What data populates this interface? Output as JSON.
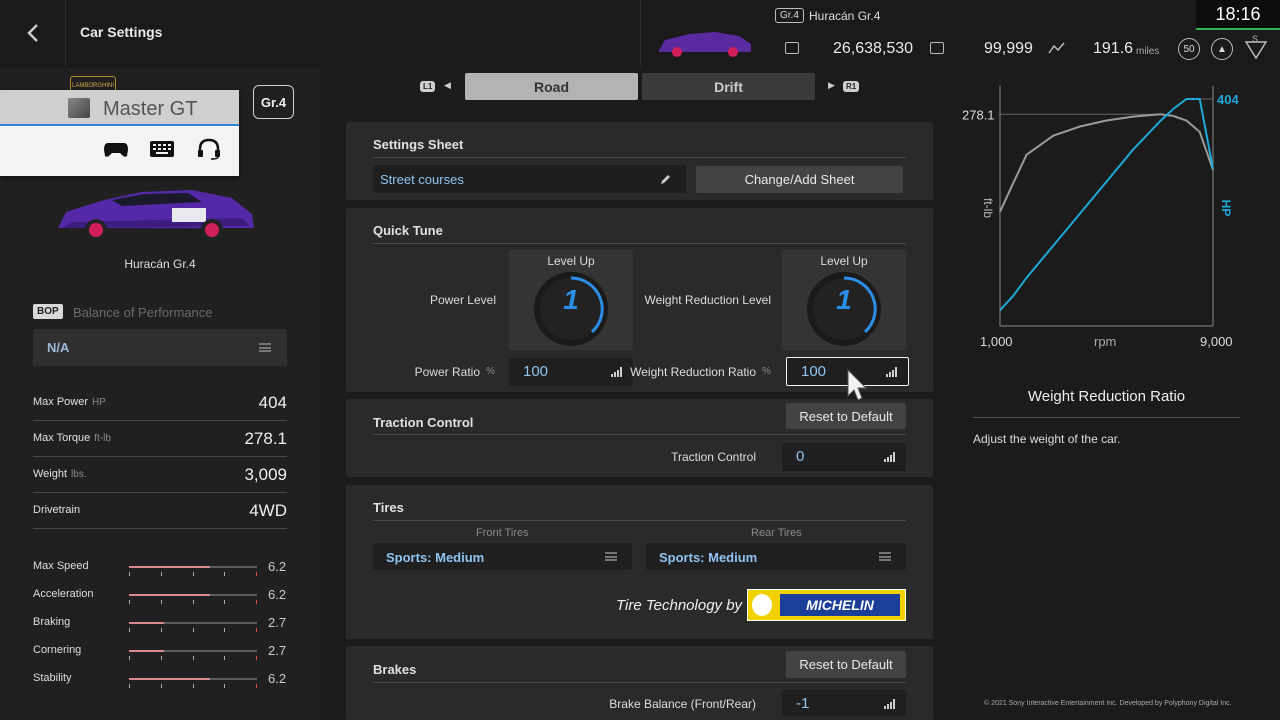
{
  "header": {
    "back_label": "‹",
    "title": "Car Settings",
    "car_class": "Gr.4",
    "car_name": "Huracán Gr.4",
    "credits": "26,638,530",
    "mileage_points": "99,999",
    "distance": "191.6",
    "distance_unit": "miles",
    "level": "50",
    "clock": "18:16"
  },
  "popup": {
    "user_name": "Master GT",
    "icons": [
      "gamepad-icon",
      "keyboard-icon",
      "headset-icon"
    ]
  },
  "left": {
    "brand_logo_text": "LAMBORGHINI",
    "class_badge": "Gr.4",
    "car_name": "Huracán Gr.4",
    "bop_badge": "BOP",
    "bop_label": "Balance of Performance",
    "bop_value": "N/A",
    "specs": [
      {
        "label": "Max Power",
        "unit": "HP",
        "value": "404"
      },
      {
        "label": "Max Torque",
        "unit": "ft-lb",
        "value": "278.1"
      },
      {
        "label": "Weight",
        "unit": "lbs.",
        "value": "3,009"
      },
      {
        "label": "Drivetrain",
        "unit": "",
        "value": "4WD"
      }
    ],
    "performance": [
      {
        "label": "Max Speed",
        "value": "6.2",
        "fill": 0.63
      },
      {
        "label": "Acceleration",
        "value": "6.2",
        "fill": 0.63
      },
      {
        "label": "Braking",
        "value": "2.7",
        "fill": 0.27
      },
      {
        "label": "Cornering",
        "value": "2.7",
        "fill": 0.27
      },
      {
        "label": "Stability",
        "value": "6.2",
        "fill": 0.63
      }
    ]
  },
  "tabs": {
    "left_shoulder": "L1",
    "right_shoulder": "R1",
    "items": [
      "Road",
      "Drift"
    ],
    "active": "Road"
  },
  "settings_sheet": {
    "title": "Settings Sheet",
    "sheet_name": "Street courses",
    "change_button": "Change/Add Sheet"
  },
  "quick_tune": {
    "title": "Quick Tune",
    "level_up_label": "Level Up",
    "power_level_label": "Power Level",
    "power_level_value": "1",
    "weight_level_label": "Weight Reduction Level",
    "weight_level_value": "1",
    "power_ratio_label": "Power Ratio",
    "weight_ratio_label": "Weight Reduction Ratio",
    "percent": "%",
    "power_ratio_value": "100",
    "weight_ratio_value": "100"
  },
  "traction": {
    "title": "Traction Control",
    "reset_label": "Reset to Default",
    "field_label": "Traction Control",
    "value": "0"
  },
  "tires": {
    "title": "Tires",
    "front_head": "Front Tires",
    "rear_head": "Rear Tires",
    "front_value": "Sports: Medium",
    "rear_value": "Sports: Medium",
    "sponsor_text": "Tire Technology by",
    "sponsor_logo": "MICHELIN"
  },
  "brakes": {
    "title": "Brakes",
    "reset_label": "Reset to Default",
    "balance_label": "Brake Balance (Front/Rear)",
    "balance_value": "-1"
  },
  "right": {
    "title": "Weight Reduction Ratio",
    "description": "Adjust the weight of the car.",
    "copyright": "© 2021 Sony Interactive Entertainment Inc. Developed by Polyphony Digital Inc."
  },
  "chart_data": {
    "type": "line",
    "x": [
      1000,
      1500,
      2000,
      3000,
      4000,
      5000,
      6000,
      7000,
      7500,
      8000,
      8500,
      9000
    ],
    "series": [
      {
        "name": "ft-lb",
        "color": "#9a9a9a",
        "values": [
          150,
          188,
          225,
          250,
          262,
          270,
          275,
          278.1,
          276,
          270,
          255,
          205
        ]
      },
      {
        "name": "HP",
        "color": "#1ea8d8",
        "values": [
          28,
          54,
          86,
          143,
          200,
          257,
          314,
          364,
          386,
          404,
          404,
          280
        ]
      }
    ],
    "xlabel": "rpm",
    "x_tick_labels": [
      "1,000",
      "9,000"
    ],
    "left_axis_label": "ft-lb",
    "right_axis_label": "HP",
    "left_mark": "278.1",
    "right_mark": "404",
    "xlim": [
      1000,
      9000
    ],
    "y_left_lim": [
      0,
      310
    ],
    "y_right_lim": [
      0,
      420
    ]
  }
}
